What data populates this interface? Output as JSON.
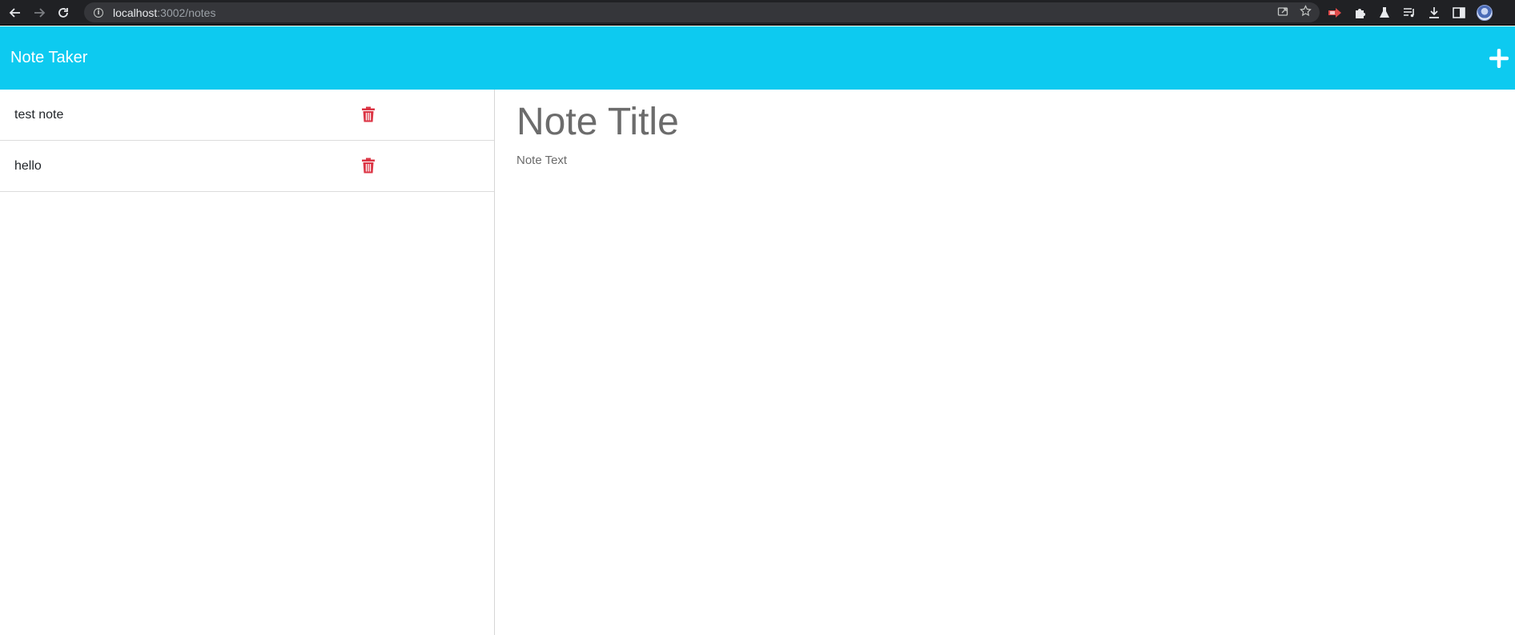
{
  "browser": {
    "url_host": "localhost",
    "url_path": ":3002/notes",
    "icons": {
      "back": "arrow-left-icon",
      "forward": "arrow-right-icon",
      "reload": "reload-icon",
      "info": "info-icon",
      "share": "share-icon",
      "bookmark": "star-icon",
      "extensions": [
        "red-extension-icon",
        "puzzle-icon",
        "flask-icon",
        "media-queue-icon",
        "download-icon",
        "side-panel-icon",
        "profile-avatar"
      ]
    }
  },
  "app": {
    "brand": "Note Taker",
    "new_note_icon": "plus-icon",
    "header_color": "#0dcaf0"
  },
  "notes": [
    {
      "title": "test note",
      "delete_icon": "trash-icon"
    },
    {
      "title": "hello",
      "delete_icon": "trash-icon"
    }
  ],
  "editor": {
    "title_placeholder": "Note Title",
    "text_placeholder": "Note Text"
  },
  "colors": {
    "delete": "#dc3545",
    "placeholder": "#6c6c6c"
  }
}
